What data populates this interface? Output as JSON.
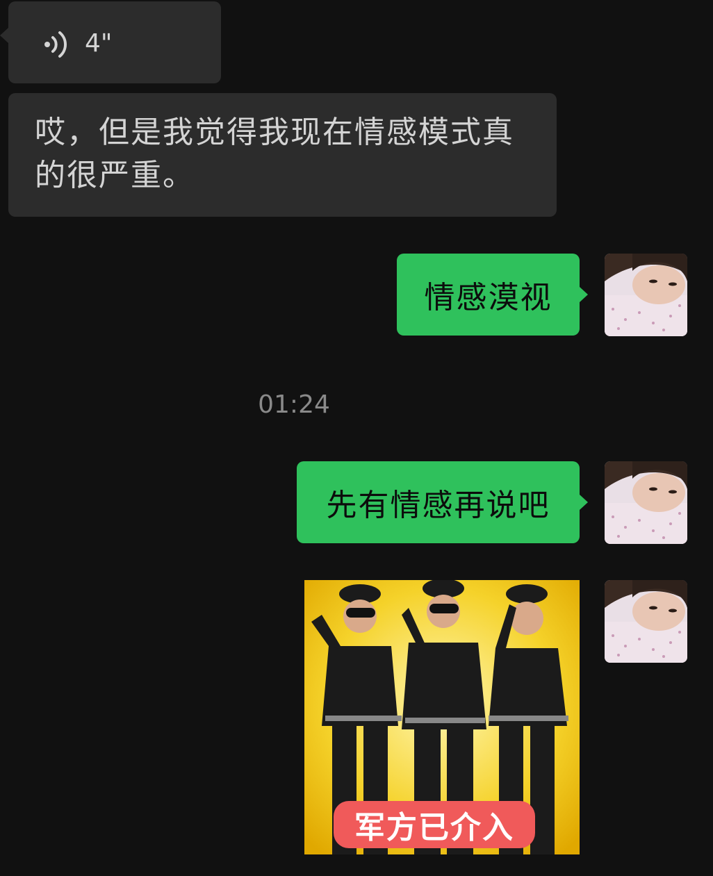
{
  "chat": {
    "messages": [
      {
        "direction": "incoming",
        "type": "voice",
        "duration": "4\"",
        "icon": "voice-wave-icon"
      },
      {
        "direction": "incoming",
        "type": "text",
        "text": "哎，但是我觉得我现在情感模式真的很严重。"
      },
      {
        "direction": "outgoing",
        "type": "text",
        "text": "情感漠视"
      },
      {
        "direction": "system",
        "type": "timestamp",
        "text": "01:24"
      },
      {
        "direction": "outgoing",
        "type": "text",
        "text": "先有情感再说吧"
      },
      {
        "direction": "outgoing",
        "type": "sticker",
        "caption": "军方已介入"
      }
    ]
  },
  "colors": {
    "background": "#111111",
    "incoming_bubble": "#2c2c2c",
    "outgoing_bubble": "#2fc15c",
    "timestamp": "#8a8a8a",
    "sticker_caption_bg": "#f05a5a"
  }
}
